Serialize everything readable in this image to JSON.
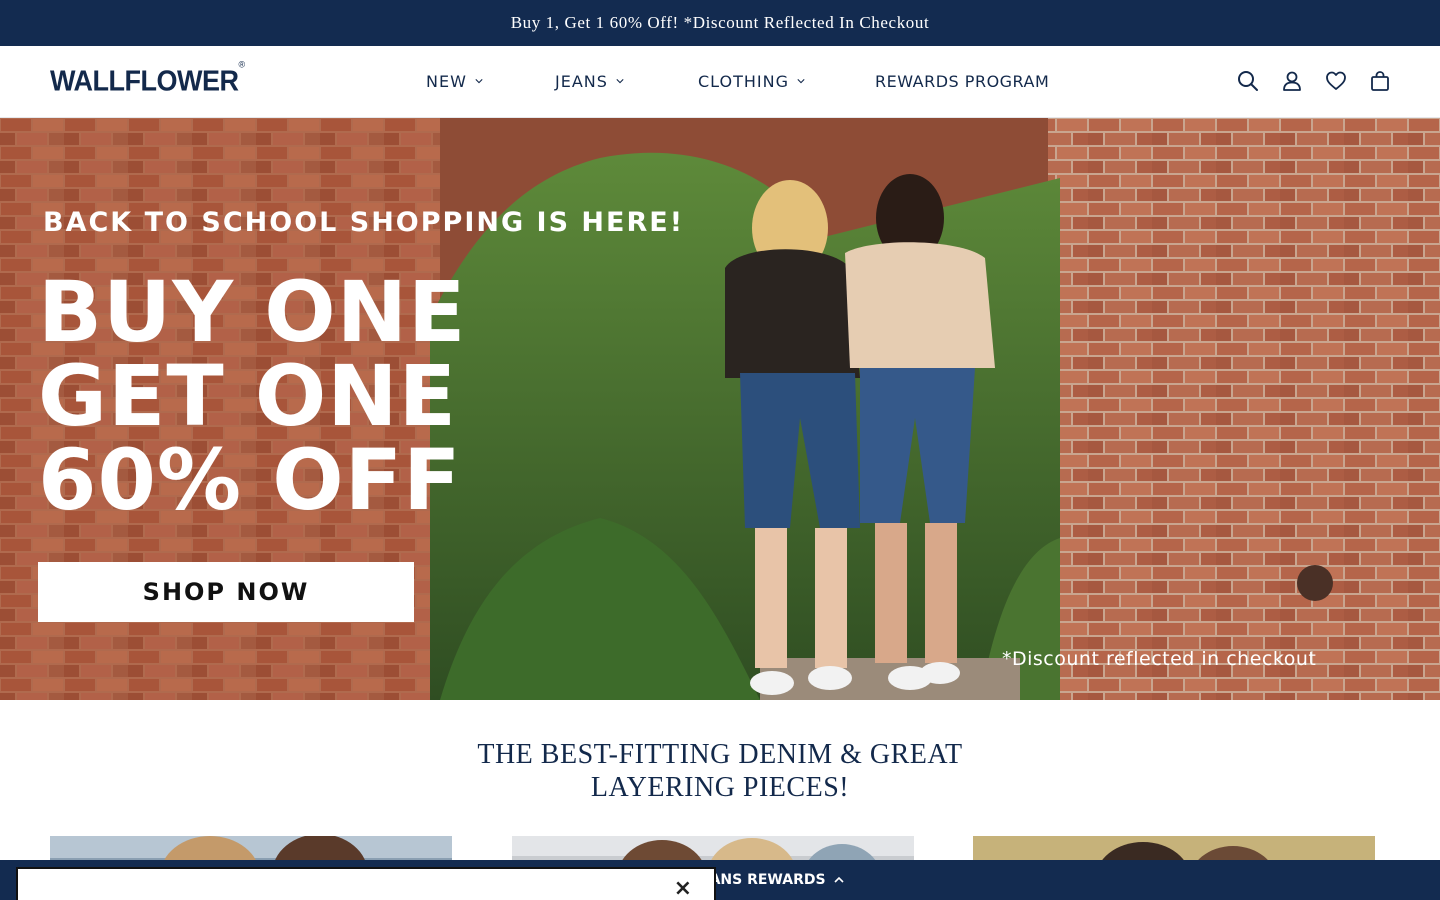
{
  "announcement": {
    "text": "Buy 1, Get 1 60% Off! *Discount Reflected In Checkout"
  },
  "header": {
    "logo_text": "WALLFLOWER",
    "logo_mark": "®",
    "nav": [
      {
        "label": "NEW",
        "has_dropdown": true
      },
      {
        "label": "JEANS",
        "has_dropdown": true
      },
      {
        "label": "CLOTHING",
        "has_dropdown": true
      },
      {
        "label": "REWARDS PROGRAM",
        "has_dropdown": false
      }
    ],
    "icons": [
      "search-icon",
      "account-icon",
      "wishlist-heart-icon",
      "cart-bag-icon"
    ]
  },
  "hero": {
    "kicker": "BACK TO SCHOOL SHOPPING IS HERE!",
    "headline": [
      "BUY ONE",
      "GET ONE",
      "60% OFF"
    ],
    "cta_label": "SHOP NOW",
    "disclaimer": "*Discount reflected in checkout"
  },
  "section": {
    "title_line1": "THE BEST-FITTING DENIM & GREAT",
    "title_line2": "LAYERING PIECES!"
  },
  "rewards_bar": {
    "label": "EANS REWARDS"
  },
  "popup": {
    "close_label": "×"
  },
  "colors": {
    "navy": "#132b50",
    "text_navy": "#13294b",
    "brick": "#a95a3e",
    "white": "#ffffff"
  }
}
